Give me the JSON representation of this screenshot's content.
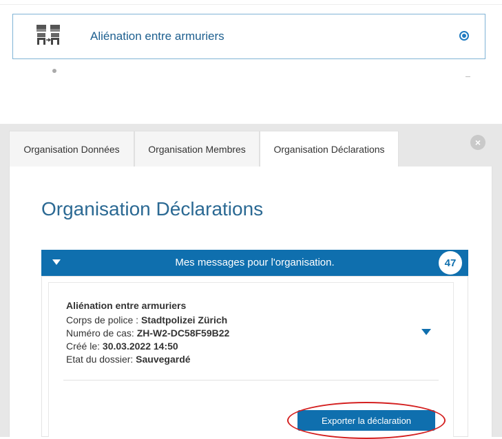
{
  "option": {
    "label": "Aliénation entre armuriers",
    "selected": true,
    "icon": "shop-transfer-icon"
  },
  "modal": {
    "tabs": [
      {
        "label": "Organisation Données",
        "active": false
      },
      {
        "label": "Organisation Membres",
        "active": false
      },
      {
        "label": "Organisation Déclarations",
        "active": true
      }
    ],
    "close_icon": "×",
    "page_title": "Organisation Déclarations",
    "accordion": {
      "title": "Mes messages pour l'organisation.",
      "count": "47"
    },
    "case": {
      "title": "Aliénation entre armuriers",
      "police_label": "Corps de police : ",
      "police_value": "Stadtpolizei Zürich",
      "case_no_label": "Numéro de cas: ",
      "case_no_value": "ZH-W2-DC58F59B22",
      "created_label": "Créé le: ",
      "created_value": "30.03.2022 14:50",
      "status_label": "Etat du dossier: ",
      "status_value": "Sauvegardé"
    },
    "export_button": "Exporter la déclaration"
  },
  "colors": {
    "primary": "#0f6fae",
    "title": "#2b6993",
    "highlight": "#d42020"
  }
}
